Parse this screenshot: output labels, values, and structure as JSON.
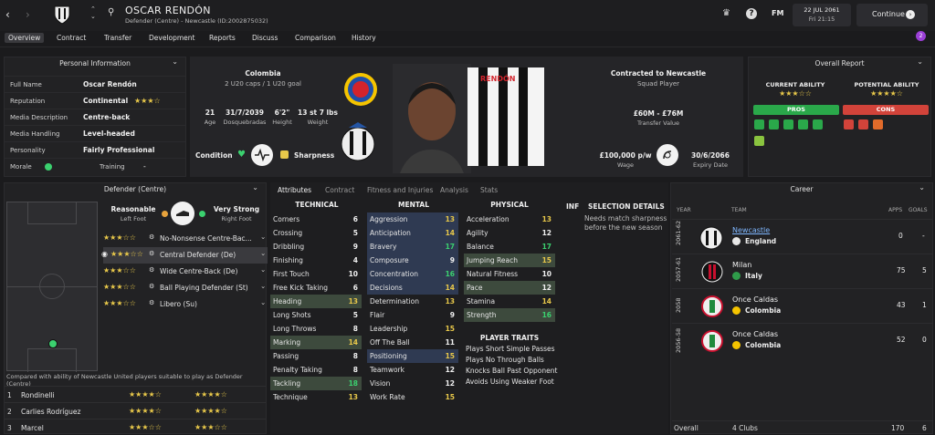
{
  "header": {
    "player_name": "OSCAR RENDÓN",
    "subtitle": "Defender (Centre) - Newcastle (ID:2002875032)",
    "brand": "FM",
    "date": "22 JUL 2061",
    "day_time": "Fri 21:15",
    "continue_label": "Continue",
    "notif_count": "2"
  },
  "nav": [
    "Overview",
    "Contract",
    "Transfer",
    "Development",
    "Reports",
    "Discuss",
    "Comparison",
    "History"
  ],
  "personal": {
    "title": "Personal Information",
    "rows": [
      {
        "label": "Full Name",
        "value": "Oscar Rendón"
      },
      {
        "label": "Reputation",
        "value": "Continental",
        "stars": "★★★☆"
      },
      {
        "label": "Media Description",
        "value": "Centre-back"
      },
      {
        "label": "Media Handling",
        "value": "Level-headed"
      },
      {
        "label": "Personality",
        "value": "Fairly Professional"
      }
    ],
    "morale_label": "Morale",
    "training_label": "Training",
    "training_value": "-"
  },
  "profile": {
    "nation": "Colombia",
    "caps": "2 U20 caps / 1 U20 goal",
    "age": "21",
    "age_label": "Age",
    "dob": "31/7/2039",
    "dob_label": "Dosquebradas",
    "height": "6'2\"",
    "height_label": "Height",
    "weight": "13 st 7 lbs",
    "weight_label": "Weight",
    "condition_label": "Condition",
    "sharpness_label": "Sharpness",
    "shirt_name": "RENDÓN"
  },
  "contract": {
    "title": "Contracted to Newcastle",
    "status": "Squad Player",
    "value": "£60M - £76M",
    "value_label": "Transfer Value",
    "wage": "£100,000 p/w",
    "wage_label": "Wage",
    "expiry": "30/6/2066",
    "expiry_label": "Expiry Date"
  },
  "report": {
    "title": "Overall Report",
    "current_label": "CURRENT ABILITY",
    "current_stars": "★★★☆☆",
    "potential_label": "POTENTIAL ABILITY",
    "potential_stars": "★★★★☆",
    "pros": "PROS",
    "cons": "CONS"
  },
  "position": {
    "title": "Defender (Centre)",
    "left_foot": "Reasonable",
    "left_foot_label": "Left Foot",
    "right_foot": "Very Strong",
    "right_foot_label": "Right Foot",
    "roles": [
      {
        "stars": "★★★☆☆",
        "name": "No-Nonsense Centre-Bac..."
      },
      {
        "stars": "★★★☆☆",
        "name": "Central Defender (De)"
      },
      {
        "stars": "★★★☆☆",
        "name": "Wide Centre-Back (De)"
      },
      {
        "stars": "★★★☆☆",
        "name": "Ball Playing Defender (St)"
      },
      {
        "stars": "★★★☆☆",
        "name": "Libero (Su)"
      }
    ],
    "compare_text": "Compared with ability of Newcastle United players suitable to play as Defender (Centre)",
    "comparison": [
      {
        "rank": "1",
        "name": "Rondinelli",
        "a": "★★★★☆",
        "b": "★★★★☆"
      },
      {
        "rank": "2",
        "name": "Carlies Rodríguez",
        "a": "★★★★☆",
        "b": "★★★★☆"
      },
      {
        "rank": "3",
        "name": "Marcel",
        "a": "★★★☆☆",
        "b": "★★★☆☆"
      }
    ]
  },
  "tabs": [
    "Attributes",
    "Contract",
    "Fitness and Injuries",
    "Analysis",
    "Stats"
  ],
  "attributes": {
    "technical_title": "TECHNICAL",
    "mental_title": "MENTAL",
    "physical_title": "PHYSICAL",
    "technical": [
      {
        "n": "Corners",
        "v": "6"
      },
      {
        "n": "Crossing",
        "v": "5"
      },
      {
        "n": "Dribbling",
        "v": "9"
      },
      {
        "n": "Finishing",
        "v": "4"
      },
      {
        "n": "First Touch",
        "v": "10"
      },
      {
        "n": "Free Kick Taking",
        "v": "6"
      },
      {
        "n": "Heading",
        "v": "13"
      },
      {
        "n": "Long Shots",
        "v": "5"
      },
      {
        "n": "Long Throws",
        "v": "8"
      },
      {
        "n": "Marking",
        "v": "14"
      },
      {
        "n": "Passing",
        "v": "8"
      },
      {
        "n": "Penalty Taking",
        "v": "8"
      },
      {
        "n": "Tackling",
        "v": "18"
      },
      {
        "n": "Technique",
        "v": "13"
      }
    ],
    "mental": [
      {
        "n": "Aggression",
        "v": "13"
      },
      {
        "n": "Anticipation",
        "v": "14"
      },
      {
        "n": "Bravery",
        "v": "17"
      },
      {
        "n": "Composure",
        "v": "9"
      },
      {
        "n": "Concentration",
        "v": "16"
      },
      {
        "n": "Decisions",
        "v": "14"
      },
      {
        "n": "Determination",
        "v": "13"
      },
      {
        "n": "Flair",
        "v": "9"
      },
      {
        "n": "Leadership",
        "v": "15"
      },
      {
        "n": "Off The Ball",
        "v": "11"
      },
      {
        "n": "Positioning",
        "v": "15"
      },
      {
        "n": "Teamwork",
        "v": "12"
      },
      {
        "n": "Vision",
        "v": "12"
      },
      {
        "n": "Work Rate",
        "v": "15"
      }
    ],
    "physical": [
      {
        "n": "Acceleration",
        "v": "13"
      },
      {
        "n": "Agility",
        "v": "12"
      },
      {
        "n": "Balance",
        "v": "17"
      },
      {
        "n": "Jumping Reach",
        "v": "15"
      },
      {
        "n": "Natural Fitness",
        "v": "10"
      },
      {
        "n": "Pace",
        "v": "12"
      },
      {
        "n": "Stamina",
        "v": "14"
      },
      {
        "n": "Strength",
        "v": "16"
      }
    ],
    "traits_title": "PLAYER TRAITS",
    "traits": [
      "Plays Short Simple Passes",
      "Plays No Through Balls",
      "Knocks Ball Past Opponent",
      "Avoids Using Weaker Foot"
    ],
    "inf": "INF",
    "selection_title": "SELECTION DETAILS",
    "selection_text1": "Needs match sharpness",
    "selection_text2": "before the new season"
  },
  "career": {
    "title": "Career",
    "col_year": "YEAR",
    "col_team": "TEAM",
    "col_apps": "APPS",
    "col_goals": "GOALS",
    "rows": [
      {
        "year": "2061-62",
        "team": "Newcastle",
        "nation": "England",
        "apps": "0",
        "goals": "-"
      },
      {
        "year": "2057-61",
        "team": "Milan",
        "nation": "Italy",
        "apps": "75",
        "goals": "5"
      },
      {
        "year": "2058",
        "team": "Once Caldas",
        "nation": "Colombia",
        "apps": "43",
        "goals": "1"
      },
      {
        "year": "2056-58",
        "team": "Once Caldas",
        "nation": "Colombia",
        "apps": "52",
        "goals": "0"
      }
    ],
    "overall_label": "Overall",
    "overall_clubs": "4 Clubs",
    "overall_apps": "170",
    "overall_goals": "6"
  },
  "colors": {
    "accent_green": "#3bd16f",
    "star": "#e8c84a",
    "pros": "#2aa84a",
    "cons": "#d2433a",
    "link": "#7fb7ff"
  }
}
